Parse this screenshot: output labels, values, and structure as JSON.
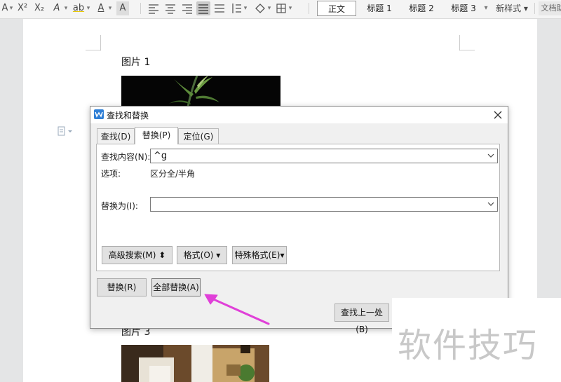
{
  "toolbar": {
    "font_color_glyph": "A",
    "superscript_glyph": "X²",
    "subscript_glyph": "X₂",
    "text_effect_glyph": "A",
    "highlight_glyph": "ab",
    "font_color2_glyph": "A",
    "char_shading_glyph": "A",
    "styles": [
      "正文",
      "标题 1",
      "标题 2",
      "标题 3"
    ],
    "new_style_label": "新样式",
    "doc_helper_label": "文档助"
  },
  "document": {
    "caption1": "图片 1",
    "caption3": "图片 3"
  },
  "dialog": {
    "title": "查找和替换",
    "tabs": [
      "查找(D)",
      "替换(P)",
      "定位(G)"
    ],
    "active_tab": "替换(P)",
    "find_label": "查找内容(N):",
    "find_value": "^g",
    "options_label": "选项:",
    "options_value": "区分全/半角",
    "replace_label": "替换为(I):",
    "replace_value": "",
    "advanced_search_label": "高级搜索(M)",
    "format_label": "格式(O)",
    "special_format_label": "特殊格式(E)",
    "replace_button": "替换(R)",
    "replace_all_button": "全部替换(A)",
    "find_previous_button": "查找上一处(B)"
  },
  "watermark": "软件技巧",
  "colors": {
    "accent": "#2f7fd6",
    "annotation_arrow": "#e040d8"
  }
}
